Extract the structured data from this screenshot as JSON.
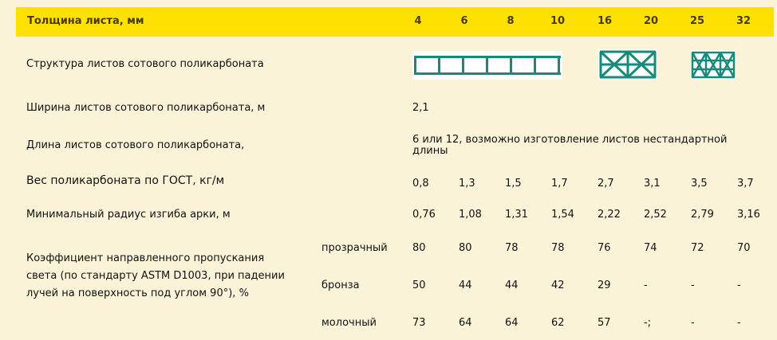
{
  "header": {
    "title": "Толщина листа, мм",
    "thicknesses": [
      "4",
      "6",
      "8",
      "10",
      "16",
      "20",
      "25",
      "32"
    ]
  },
  "rows": {
    "structure_label": "Структура листов сотового поликарбоната",
    "width_label": "Ширина листов сотового поликарбоната, м",
    "width_value": "2,1",
    "length_label": "Длина листов сотового поликарбоната,",
    "length_value": "6 или 12, возможно изготовление листов нестандартной длины",
    "weight_label": "Вес поликарбоната по ГОСТ, кг/м",
    "weight_values": [
      "0,8",
      "1,3",
      "1,5",
      "1,7",
      "2,7",
      "3,1",
      "3,5",
      "3,7"
    ],
    "radius_label": "Минимальный радиус изгиба арки, м",
    "radius_values": [
      "0,76",
      "1,08",
      "1,31",
      "1,54",
      "2,22",
      "2,52",
      "2,79",
      "3,16"
    ],
    "transmission_label": "Коэффициент направленного пропускания света (по стандарту ASTM D1003, при падении лучей на поверхность под углом 90°), %",
    "transmission": [
      {
        "name": "прозрачный",
        "values": [
          "80",
          "80",
          "78",
          "78",
          "76",
          "74",
          "72",
          "70"
        ]
      },
      {
        "name": "бронза",
        "values": [
          "50",
          "44",
          "44",
          "42",
          "29",
          "-",
          "-",
          "-"
        ]
      },
      {
        "name": "молочный",
        "values": [
          "73",
          "64",
          "64",
          "62",
          "57",
          "-;",
          "-",
          "-"
        ]
      }
    ]
  },
  "colors": {
    "header_bg": "#ffe100",
    "page_bg": "#fbf3d8",
    "structure_stroke": "#178a7a"
  }
}
